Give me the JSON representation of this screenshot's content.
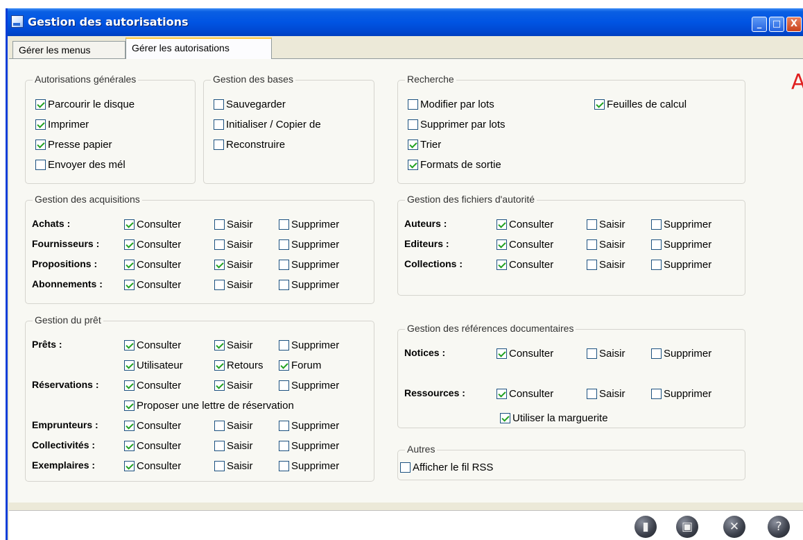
{
  "window": {
    "title": "Gestion des autorisations",
    "controls": {
      "minimize": "_",
      "maximize": "□",
      "close": "X"
    }
  },
  "tabs": [
    "Gérer les menus",
    "Gérer les autorisations"
  ],
  "corner_letter": "A",
  "general": {
    "legend": "Autorisations générales",
    "items": [
      {
        "label": "Parcourir le disque",
        "checked": true
      },
      {
        "label": "Imprimer",
        "checked": true
      },
      {
        "label": "Presse papier",
        "checked": true
      },
      {
        "label": "Envoyer des mél",
        "checked": false
      }
    ]
  },
  "bases": {
    "legend": "Gestion des bases",
    "items": [
      {
        "label": "Sauvegarder",
        "checked": false
      },
      {
        "label": "Initialiser / Copier de",
        "checked": false
      },
      {
        "label": "Reconstruire",
        "checked": false
      }
    ]
  },
  "search": {
    "legend": "Recherche",
    "items": [
      {
        "label": "Modifier par lots",
        "checked": false
      },
      {
        "label": "Supprimer par lots",
        "checked": false
      },
      {
        "label": "Trier",
        "checked": true
      },
      {
        "label": "Formats de sortie",
        "checked": true
      },
      {
        "label": "Feuilles de calcul",
        "checked": true
      }
    ]
  },
  "acquisitions": {
    "legend": "Gestion des acquisitions",
    "rows": [
      {
        "label": "Achats :",
        "consulter": true,
        "saisir": false,
        "supprimer": false
      },
      {
        "label": "Fournisseurs :",
        "consulter": true,
        "saisir": false,
        "supprimer": false
      },
      {
        "label": "Propositions :",
        "consulter": true,
        "saisir": true,
        "supprimer": false
      },
      {
        "label": "Abonnements :",
        "consulter": true,
        "saisir": false,
        "supprimer": false
      }
    ]
  },
  "authority": {
    "legend": "Gestion des fichiers d'autorité",
    "rows": [
      {
        "label": "Auteurs :",
        "consulter": true,
        "saisir": false,
        "supprimer": false
      },
      {
        "label": "Editeurs :",
        "consulter": true,
        "saisir": false,
        "supprimer": false
      },
      {
        "label": "Collections :",
        "consulter": true,
        "saisir": false,
        "supprimer": false
      }
    ]
  },
  "loan": {
    "legend": "Gestion du prêt",
    "rows": [
      {
        "label": "Prêts :",
        "consulter": true,
        "saisir": true,
        "supprimer": false
      },
      {
        "label": "Réservations :",
        "consulter": true,
        "saisir": true,
        "supprimer": false
      },
      {
        "label": "Emprunteurs :",
        "consulter": true,
        "saisir": false,
        "supprimer": false
      },
      {
        "label": "Collectivités :",
        "consulter": true,
        "saisir": false,
        "supprimer": false
      },
      {
        "label": "Exemplaires :",
        "consulter": true,
        "saisir": false,
        "supprimer": false
      }
    ],
    "utilisateur": {
      "label": "Utilisateur",
      "checked": true
    },
    "retours": {
      "label": "Retours",
      "checked": true
    },
    "forum": {
      "label": "Forum",
      "checked": true
    },
    "proposer": {
      "label": "Proposer une lettre de réservation",
      "checked": true
    }
  },
  "references": {
    "legend": "Gestion des références documentaires",
    "rows": [
      {
        "label": "Notices :",
        "consulter": true,
        "saisir": false,
        "supprimer": false
      },
      {
        "label": "Ressources :",
        "consulter": true,
        "saisir": false,
        "supprimer": false
      }
    ],
    "marguerite": {
      "label": "Utiliser la marguerite",
      "checked": true
    }
  },
  "others": {
    "legend": "Autres",
    "rss": {
      "label": "Afficher le fil RSS",
      "checked": false
    }
  },
  "perm_labels": {
    "consulter": "Consulter",
    "saisir": "Saisir",
    "supprimer": "Supprimer"
  },
  "actions": [
    {
      "icon": "document-icon",
      "glyph": "▮"
    },
    {
      "icon": "save-icon",
      "glyph": "▣"
    },
    {
      "icon": "cancel-icon",
      "glyph": "✕"
    },
    {
      "icon": "help-icon",
      "glyph": "?"
    }
  ]
}
